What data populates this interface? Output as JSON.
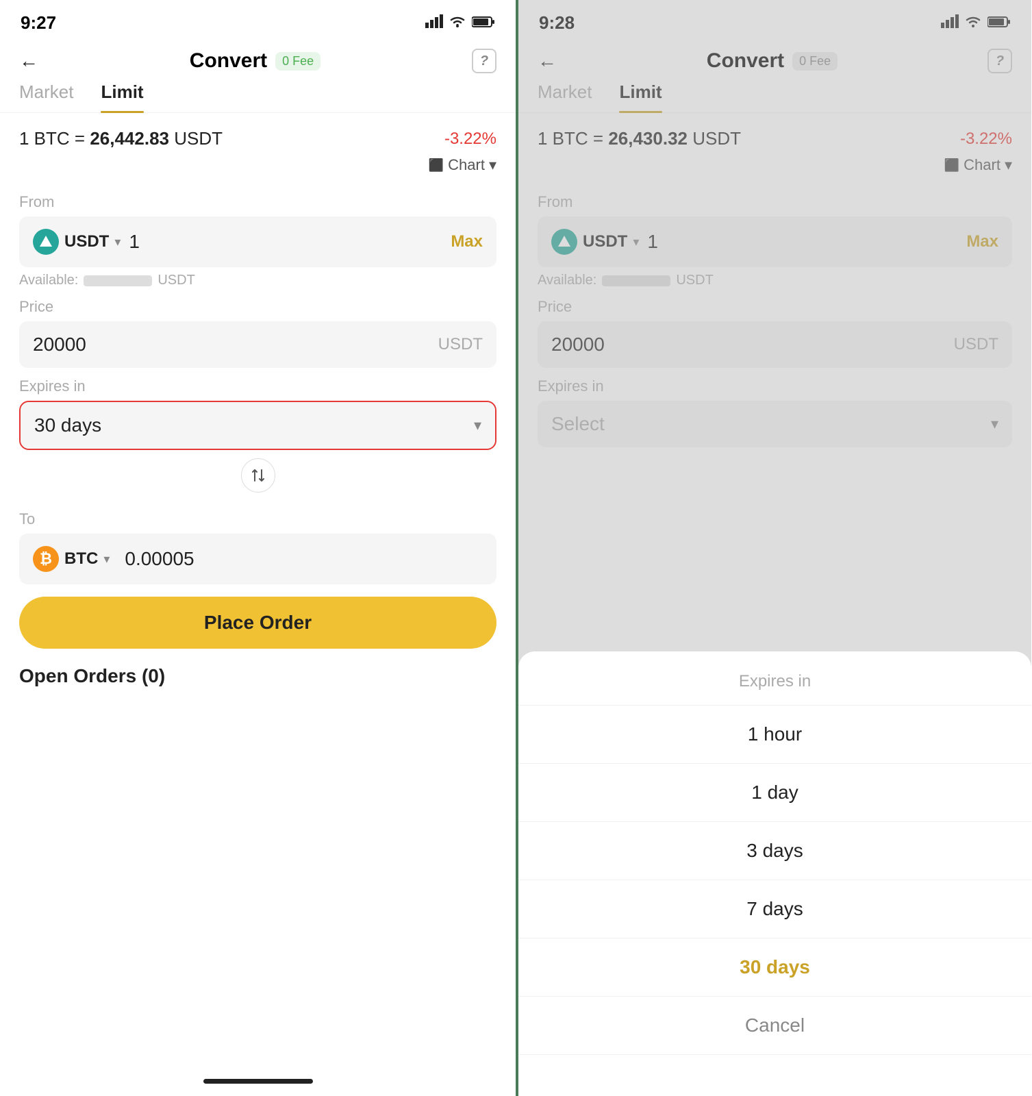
{
  "left": {
    "status": {
      "time": "9:27",
      "signal": "▲▲▲",
      "wifi": "WiFi",
      "battery": "🔋"
    },
    "header": {
      "back": "←",
      "title": "Convert",
      "fee_badge": "0 Fee",
      "help": "?"
    },
    "tabs": [
      {
        "label": "Market",
        "active": false
      },
      {
        "label": "Limit",
        "active": true
      }
    ],
    "rate": {
      "prefix": "1 BTC =",
      "value": "26,442.83",
      "suffix": "USDT",
      "change": "-3.22%"
    },
    "chart": {
      "icon": "⬛",
      "label": "Chart",
      "chevron": "▾"
    },
    "from": {
      "label": "From",
      "currency": "USDT",
      "amount": "1",
      "max": "Max",
      "available_label": "Available:",
      "available_unit": "USDT"
    },
    "price": {
      "label": "Price",
      "value": "20000",
      "unit": "USDT"
    },
    "expires": {
      "label": "Expires in",
      "value": "30 days",
      "highlighted": true
    },
    "to": {
      "label": "To",
      "currency": "BTC",
      "amount": "0.00005"
    },
    "place_order": "Place Order",
    "open_orders": "Open Orders (0)"
  },
  "right": {
    "status": {
      "time": "9:28"
    },
    "header": {
      "back": "←",
      "title": "Convert",
      "fee_badge": "0 Fee",
      "help": "?"
    },
    "tabs": [
      {
        "label": "Market",
        "active": false
      },
      {
        "label": "Limit",
        "active": true
      }
    ],
    "rate": {
      "prefix": "1 BTC =",
      "value": "26,430.32",
      "suffix": "USDT",
      "change": "-3.22%"
    },
    "chart": {
      "icon": "⬛",
      "label": "Chart",
      "chevron": "▾"
    },
    "from": {
      "label": "From",
      "currency": "USDT",
      "amount": "1",
      "max": "Max",
      "available_label": "Available:",
      "available_unit": "USDT"
    },
    "price": {
      "label": "Price",
      "value": "20000",
      "unit": "USDT"
    },
    "expires": {
      "label": "Expires in"
    },
    "sheet": {
      "title": "Expires in",
      "options": [
        {
          "label": "1 hour",
          "selected": false
        },
        {
          "label": "1 day",
          "selected": false
        },
        {
          "label": "3 days",
          "selected": false
        },
        {
          "label": "7 days",
          "selected": false
        },
        {
          "label": "30 days",
          "selected": true
        },
        {
          "label": "Cancel",
          "cancel": true
        }
      ]
    }
  },
  "colors": {
    "accent_yellow": "#c9a227",
    "accent_green": "#4caf50",
    "accent_red": "#e53935",
    "highlight_red": "#e53935",
    "btc_orange": "#f7931a",
    "usdt_teal": "#26a69a"
  }
}
